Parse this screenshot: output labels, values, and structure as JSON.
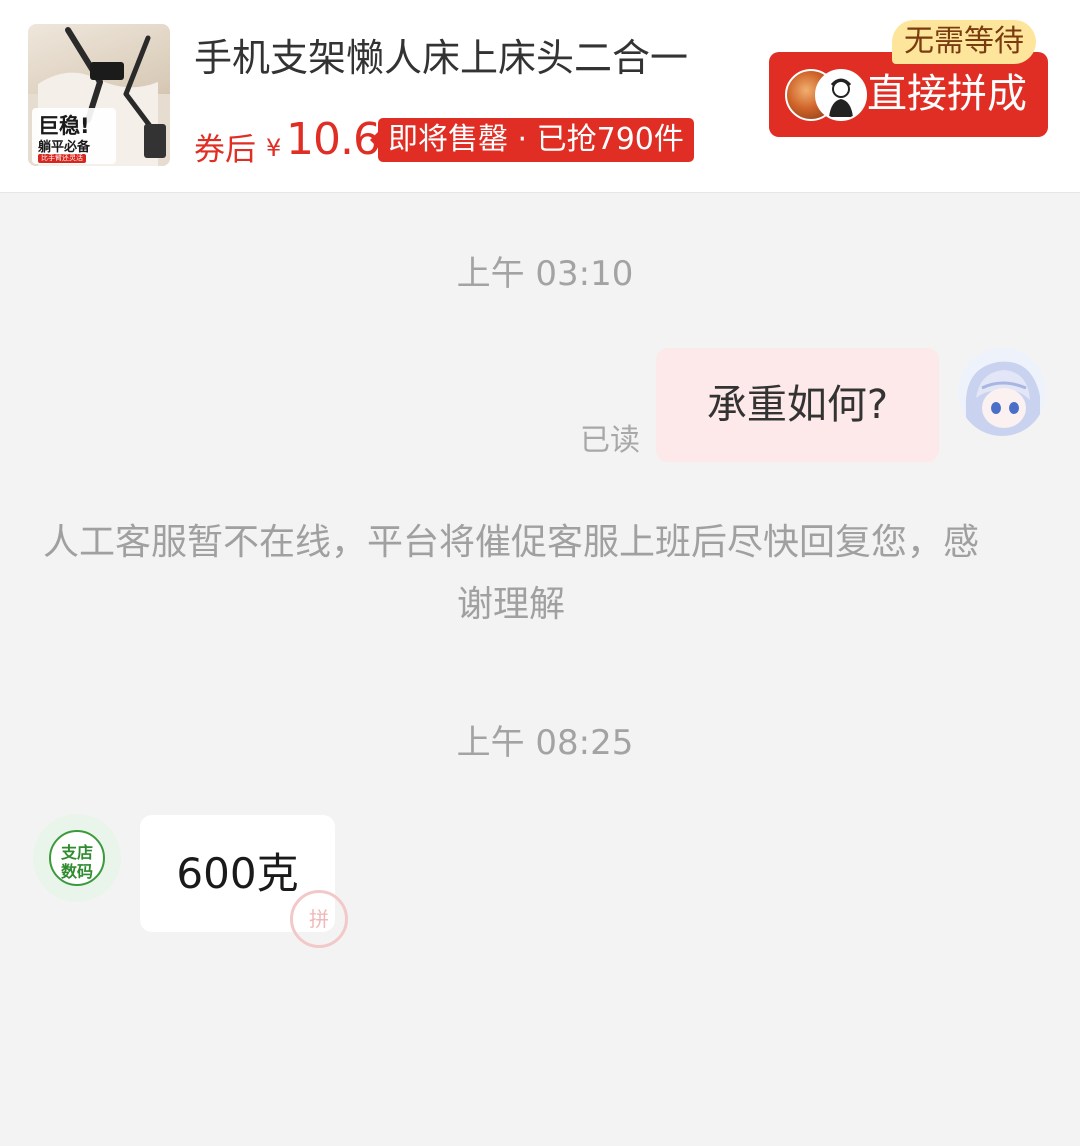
{
  "product": {
    "title": "手机支架懒人床上床头二合一",
    "thumbnail": {
      "badge_main": "巨稳!",
      "badge_sub": "躺平必备",
      "badge_tag": "比手臂还灵活"
    },
    "price_prefix": "券后",
    "currency": "¥",
    "price": "10.6",
    "sale_tag": "即将售罄 · 已抢790件",
    "no_wait_badge": "无需等待",
    "direct_button_label": "直接拼成"
  },
  "chat": {
    "timestamp_1": "上午 03:10",
    "my_message": "承重如何?",
    "read_status": "已读",
    "system_notice": "人工客服暂不在线，平台将催促客服上班后尽快回复您，感谢理解",
    "timestamp_2": "上午 08:25",
    "shop_avatar_line1": "支店",
    "shop_avatar_line2": "数码",
    "shop_message": "600克",
    "watermark": "拼"
  },
  "colors": {
    "brand_red": "#e02e24",
    "badge_yellow": "#fde69b",
    "my_bubble": "#fde9e9",
    "background": "#f3f3f3"
  },
  "icons": {
    "user_avatar": "anime-girl-avatar",
    "shop_avatar": "shop-logo-icon",
    "buyer_avatars": [
      "buyer-avatar-food",
      "buyer-avatar-sketch"
    ]
  }
}
